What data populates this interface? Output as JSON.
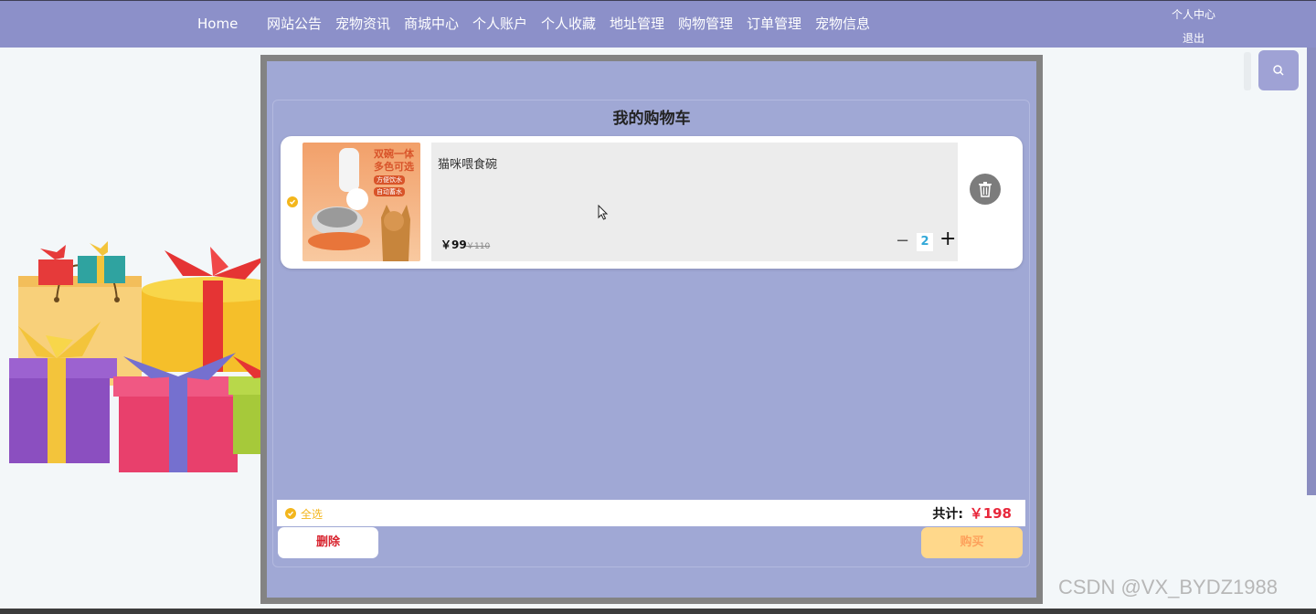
{
  "nav": {
    "items": [
      "Home",
      "网站公告",
      "宠物资讯",
      "商城中心",
      "个人账户",
      "个人收藏",
      "地址管理",
      "购物管理",
      "订单管理",
      "宠物信息"
    ],
    "user_center": "个人中心",
    "logout": "退出"
  },
  "search": {
    "icon": "search-icon"
  },
  "cart": {
    "title": "我的购物车",
    "item": {
      "name": "猫咪喂食碗",
      "price": "￥99",
      "original_price": "￥110",
      "quantity": "2",
      "image_text": [
        "双碗一体",
        "多色可选",
        "方便饮水",
        "自动蓄水"
      ]
    },
    "select_all": "全选",
    "total_label": "共计:",
    "total_value": "￥198",
    "delete_label": "删除",
    "buy_label": "购买"
  },
  "watermark": "CSDN @VX_BYDZ1988",
  "colors": {
    "nav_bg": "#8c90c9",
    "modal_bg": "#a0a8d5",
    "accent_yellow": "#f3b61c",
    "price_red": "#e8283c",
    "buy_bg": "#ffd88b"
  }
}
